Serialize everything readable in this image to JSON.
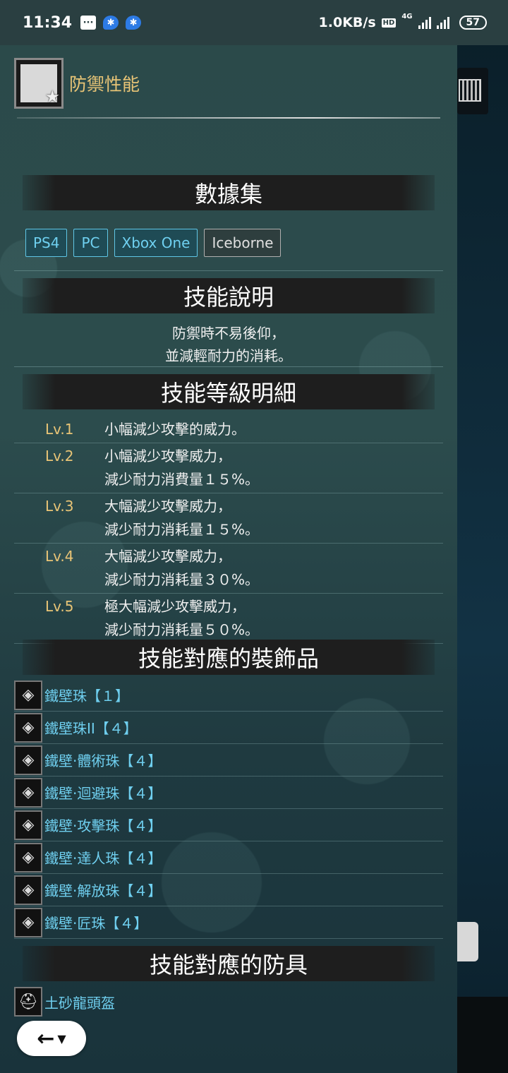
{
  "status_bar": {
    "time": "11:34",
    "network_speed": "1.0KB/s",
    "hd": "HD",
    "network_type": "4G",
    "battery": "57"
  },
  "skill": {
    "title": "防禦性能",
    "icon": "shield-skill-icon"
  },
  "sections": {
    "dataset": "數據集",
    "description": "技能說明",
    "level_detail": "技能等級明細",
    "decorations": "技能對應的裝飾品",
    "armor": "技能對應的防具"
  },
  "platform_tags": [
    "PS4",
    "PC",
    "Xbox One",
    "Iceborne"
  ],
  "description_lines": [
    "防禦時不易後仰，",
    "並減輕耐力的消耗。"
  ],
  "levels": [
    {
      "lv": "Lv.1",
      "text": "小幅減少攻擊的威力。"
    },
    {
      "lv": "Lv.2",
      "text": "小幅減少攻擊威力，\n減少耐力消費量１５%。"
    },
    {
      "lv": "Lv.3",
      "text": "大幅減少攻擊威力，\n減少耐力消耗量１５%。"
    },
    {
      "lv": "Lv.4",
      "text": "大幅減少攻擊威力，\n減少耐力消耗量３０%。"
    },
    {
      "lv": "Lv.5",
      "text": "極大幅減少攻擊威力，\n減少耐力消耗量５０%。"
    }
  ],
  "decorations": [
    "鐵壁珠【１】",
    "鐵壁珠II【４】",
    "鐵壁·體術珠【４】",
    "鐵壁·迴避珠【４】",
    "鐵壁·攻擊珠【４】",
    "鐵壁·達人珠【４】",
    "鐵壁·解放珠【４】",
    "鐵壁·匠珠【４】"
  ],
  "armor": [
    "土砂龍頭盔"
  ],
  "colors": {
    "accent_gold": "#e8c476",
    "link_blue": "#6fcfef",
    "tag_border": "#5fc6e6"
  }
}
